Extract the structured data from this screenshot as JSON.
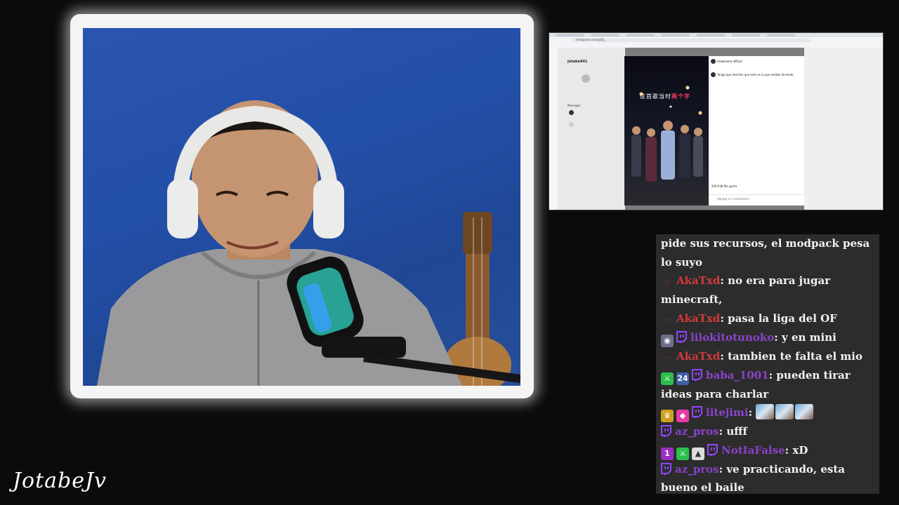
{
  "logo": {
    "text": "JotabeJv"
  },
  "screen": {
    "url": "instagram.com/p/DJ...",
    "profile_name": "Jotabe941",
    "messages_label": "Mensajes",
    "video_caption_a": "这首歌当时",
    "video_caption_b": "两个字",
    "post_account": "Asiabroma official",
    "post_comment": "Tengo que decirles que esto es lo que estaba diciendo",
    "likes": "200.038 Me gusta",
    "add_comment": "Agrega un comentario..."
  },
  "chat": {
    "messages": [
      {
        "user": "",
        "user_color": "",
        "badges": [],
        "text": "pide sus recursos, el modpack pesa lo suyo"
      },
      {
        "user": "AkaTxd",
        "user_color": "red",
        "badges": [
          "heart-outline"
        ],
        "text": ": no era para jugar minecraft,"
      },
      {
        "user": "AkaTxd",
        "user_color": "red",
        "badges": [
          "heart-outline"
        ],
        "text": ": pasa la liga del OF"
      },
      {
        "user": "lilokitotunoko",
        "user_color": "purple",
        "badges": [
          "goggles",
          "twitch"
        ],
        "text": ": y en mini"
      },
      {
        "user": "AkaTxd",
        "user_color": "red",
        "badges": [
          "heart-outline"
        ],
        "text": ": tambien te falta el mio"
      },
      {
        "user": "baba_1001",
        "user_color": "purple",
        "badges": [
          "sword",
          "24",
          "twitch"
        ],
        "text": ": pueden tirar ideas para charlar"
      },
      {
        "user": "litejimi",
        "user_color": "purple",
        "badges": [
          "crown",
          "gem",
          "twitch"
        ],
        "text": ":",
        "emotes": 3
      },
      {
        "user": "az_pros",
        "user_color": "purple",
        "badges": [
          "twitch"
        ],
        "text": ": ufff"
      },
      {
        "user": "NotIaFalse",
        "user_color": "purple",
        "badges": [
          "1st",
          "sword",
          "triangle",
          "twitch"
        ],
        "text": ": xD"
      },
      {
        "user": "az_pros",
        "user_color": "purple",
        "badges": [
          "twitch"
        ],
        "text": ": ve practicando, esta bueno el baile"
      }
    ]
  },
  "colors": {
    "chat_bg": "#2c2c2c",
    "user_red": "#d23b3b",
    "user_purple": "#8a43c9",
    "cam_bg": "#2352aa"
  }
}
